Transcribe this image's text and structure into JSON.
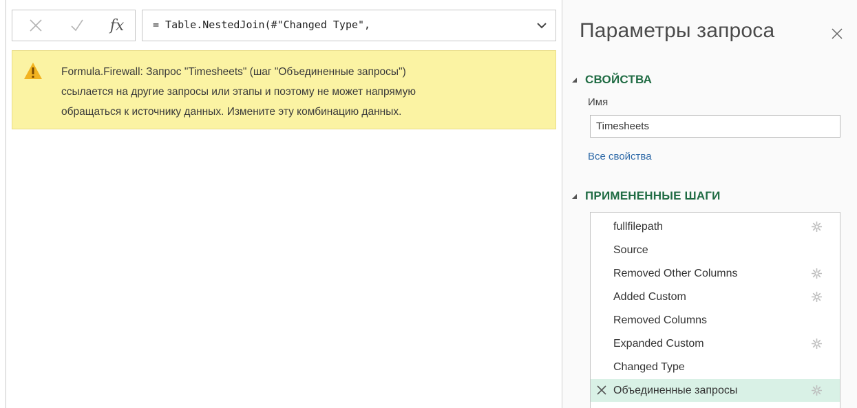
{
  "formula_bar": {
    "cancel_icon": "x-icon",
    "commit_icon": "check-icon",
    "fx_label": "fx",
    "formula": "= Table.NestedJoin(#\"Changed Type\","
  },
  "error": {
    "line1": "Formula.Firewall: Запрос \"Timesheets\" (шаг \"Объединенные запросы\")",
    "line2": "ссылается на другие запросы или этапы и поэтому не может напрямую",
    "line3": "обращаться к источнику данных. Измените эту комбинацию данных.",
    "color": "#fbf3a3"
  },
  "query_settings": {
    "title": "Параметры запроса",
    "properties": {
      "heading": "СВОЙСТВА",
      "name_label": "Имя",
      "name_value": "Timesheets",
      "all_props_link": "Все свойства"
    },
    "steps": {
      "heading": "ПРИМЕНЕННЫЕ ШАГИ",
      "items": [
        {
          "label": "fullfilepath",
          "gear": true,
          "error": false,
          "selected": false
        },
        {
          "label": "Source",
          "gear": false,
          "error": false,
          "selected": false
        },
        {
          "label": "Removed Other Columns",
          "gear": true,
          "error": false,
          "selected": false
        },
        {
          "label": "Added Custom",
          "gear": true,
          "error": false,
          "selected": false
        },
        {
          "label": "Removed Columns",
          "gear": false,
          "error": false,
          "selected": false
        },
        {
          "label": "Expanded Custom",
          "gear": true,
          "error": false,
          "selected": false
        },
        {
          "label": "Changed Type",
          "gear": false,
          "error": false,
          "selected": false
        },
        {
          "label": "Объединенные запросы",
          "gear": true,
          "error": true,
          "selected": true
        }
      ]
    },
    "accent_color": "#1f6b43",
    "link_color": "#2f6aa8"
  }
}
